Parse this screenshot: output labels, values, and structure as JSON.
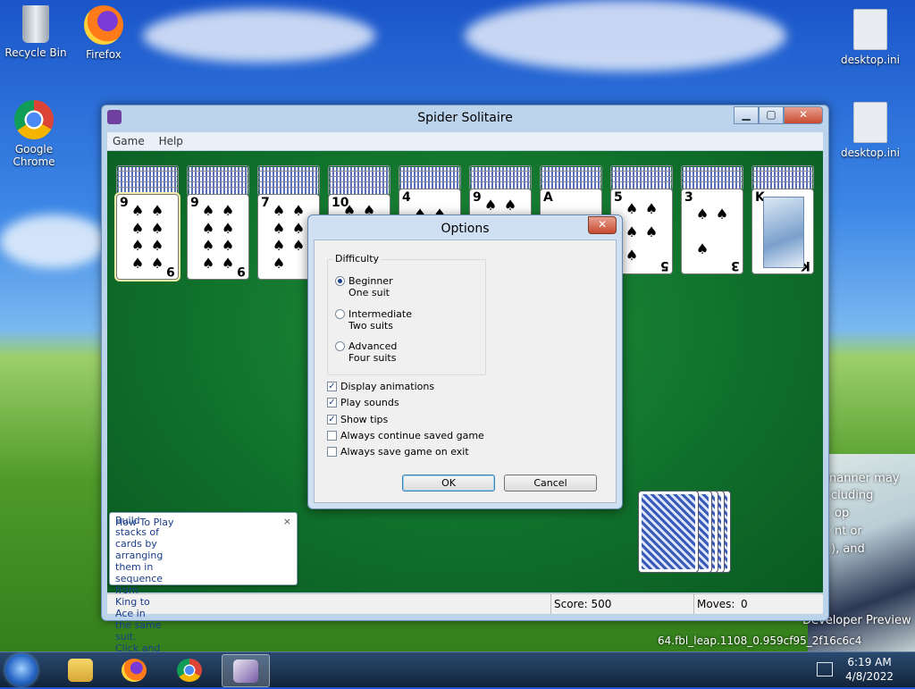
{
  "desktop": {
    "icons": [
      {
        "label": "Recycle Bin"
      },
      {
        "label": "Firefox"
      },
      {
        "label": "Google Chrome"
      },
      {
        "label": "desktop.ini"
      },
      {
        "label": "desktop.ini"
      }
    ],
    "watermark": {
      "line1": "Developer Preview",
      "line2": "64.fbl_leap.1108_0.959cf95_2f16c6c4",
      "fragments": [
        "nanner may",
        "cluding",
        "op",
        "nt or",
        "), and"
      ]
    }
  },
  "window": {
    "title": "Spider Solitaire",
    "controls": {
      "minimize": "▁",
      "maximize": "▢",
      "close": "✕"
    },
    "menu": [
      "Game",
      "Help"
    ],
    "columns": [
      {
        "rank": "9",
        "suit": "♠"
      },
      {
        "rank": "9",
        "suit": "♠"
      },
      {
        "rank": "7",
        "suit": "♠"
      },
      {
        "rank": "10",
        "suit": "♠"
      },
      {
        "rank": "4",
        "suit": "♠"
      },
      {
        "rank": "9",
        "suit": "♠"
      },
      {
        "rank": "A",
        "suit": "♠"
      },
      {
        "rank": "5",
        "suit": "♠"
      },
      {
        "rank": "3",
        "suit": "♠"
      },
      {
        "rank": "K",
        "suit": "♠"
      }
    ],
    "status": {
      "score": "Score: 500",
      "moves_label": "Moves:",
      "moves_value": "0"
    }
  },
  "how_to_play": {
    "title": "How To Play",
    "body": "Build stacks of cards by arranging them in sequence from King to Ace in the same suit. Click and drag a card to move it.",
    "close": "×"
  },
  "options_dialog": {
    "title": "Options",
    "close": "✕",
    "difficulty_label": "Difficulty",
    "difficulty": [
      {
        "name": "Beginner",
        "detail": "One suit",
        "selected": true
      },
      {
        "name": "Intermediate",
        "detail": "Two suits",
        "selected": false
      },
      {
        "name": "Advanced",
        "detail": "Four suits",
        "selected": false
      }
    ],
    "options": [
      {
        "label": "Display animations",
        "checked": true
      },
      {
        "label": "Play sounds",
        "checked": true
      },
      {
        "label": "Show tips",
        "checked": true
      },
      {
        "label": "Always continue saved game",
        "checked": false
      },
      {
        "label": "Always save game on exit",
        "checked": false
      }
    ],
    "ok": "OK",
    "cancel": "Cancel"
  },
  "taskbar": {
    "time": "6:19 AM",
    "date": "4/8/2022"
  }
}
